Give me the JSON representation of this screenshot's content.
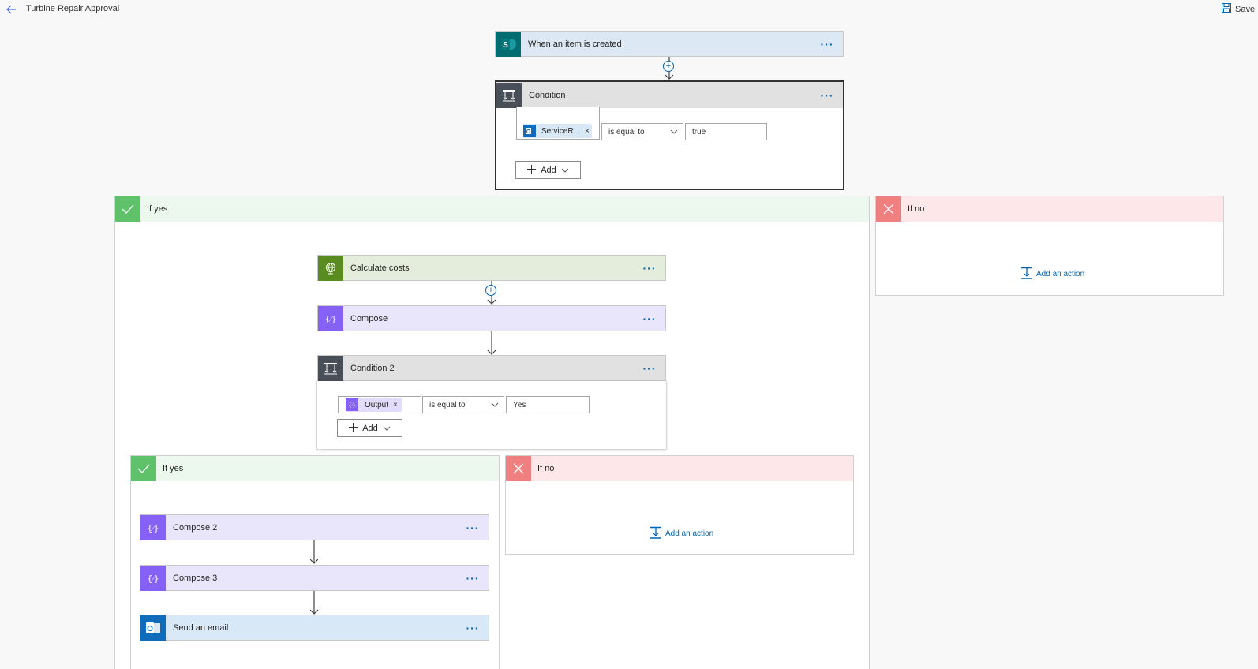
{
  "header": {
    "title": "Turbine Repair Approval",
    "save_label": "Save"
  },
  "trigger": {
    "label": "When an item is created",
    "more": "···"
  },
  "condition": {
    "label": "Condition",
    "more": "···",
    "token": "ServiceR...",
    "operator": "is equal to",
    "value": "true",
    "add_label": "Add"
  },
  "outer_yes": {
    "label": "If yes",
    "calc": {
      "label": "Calculate costs",
      "more": "···"
    },
    "compose": {
      "label": "Compose",
      "more": "···"
    },
    "condition2": {
      "label": "Condition 2",
      "more": "···",
      "token": "Output",
      "operator": "is equal to",
      "value": "Yes",
      "add_label": "Add"
    },
    "inner_yes": {
      "label": "If yes",
      "compose2": {
        "label": "Compose 2",
        "more": "···"
      },
      "compose3": {
        "label": "Compose 3",
        "more": "···"
      },
      "email": {
        "label": "Send an email",
        "more": "···"
      }
    },
    "inner_no": {
      "label": "If no",
      "add_action": "Add an action"
    }
  },
  "outer_no": {
    "label": "If no",
    "add_action": "Add an action"
  },
  "colors": {
    "accent": "#0063b1",
    "yes": "#5fc169",
    "no": "#f07f7f",
    "compose": "#8661f5",
    "condition": "#484f58"
  }
}
